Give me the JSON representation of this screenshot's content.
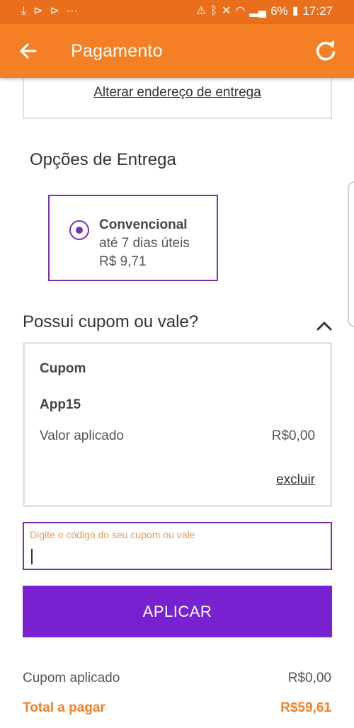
{
  "status_bar": {
    "battery": "6%",
    "time": "17:27"
  },
  "app_bar": {
    "title": "Pagamento"
  },
  "address": {
    "change_link": "Alterar endereço de entrega"
  },
  "delivery": {
    "section_title": "Opções de Entrega",
    "option": {
      "name": "Convencional",
      "time": "até 7 dias úteis",
      "price": "R$ 9,71",
      "selected": true
    }
  },
  "coupon": {
    "section_title": "Possui cupom ou vale?",
    "card": {
      "label": "Cupom",
      "code": "App15",
      "applied_label": "Valor aplicado",
      "applied_value": "R$0,00",
      "remove_link": "excluir"
    },
    "input": {
      "label": "Digite o código do seu cupom ou vale",
      "value": ""
    },
    "apply_button": "APLICAR"
  },
  "summary": {
    "coupon_label": "Cupom aplicado",
    "coupon_value": "R$0,00",
    "total_label": "Total a pagar",
    "total_value": "R$59,61"
  },
  "colors": {
    "app_bar": "#f47f24",
    "status_bar": "#e96f1c",
    "accent_purple": "#7721d1",
    "total_orange": "#f47f24"
  }
}
